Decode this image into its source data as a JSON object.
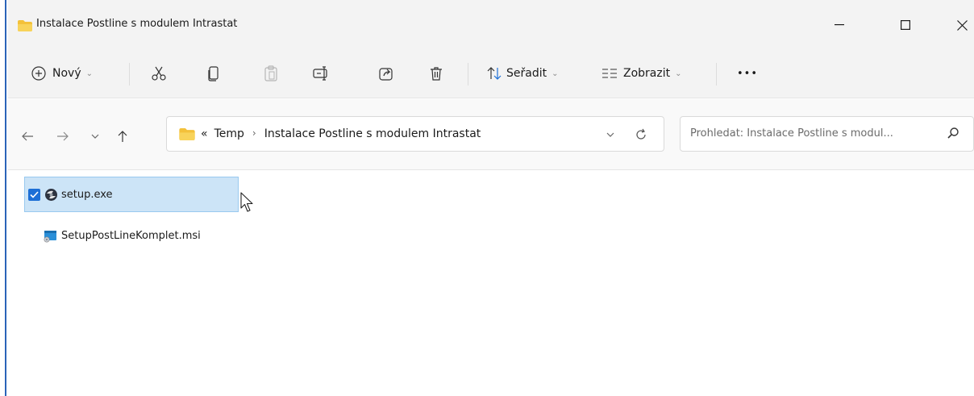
{
  "window": {
    "title": "Instalace Postline s modulem Intrastat"
  },
  "toolbar": {
    "new_label": "Nový",
    "sort_label": "Seřadit",
    "view_label": "Zobrazit",
    "more_label": "•••"
  },
  "address_bar": {
    "overflow": "«",
    "crumbs": [
      "Temp",
      "Instalace Postline s modulem Intrastat"
    ],
    "separator": "›"
  },
  "search": {
    "placeholder": "Prohledat: Instalace Postline s modul..."
  },
  "files": [
    {
      "name": "setup.exe",
      "selected": true,
      "icon": "setup-exe-icon"
    },
    {
      "name": "SetupPostLineKomplet.msi",
      "selected": false,
      "icon": "msi-installer-icon"
    }
  ],
  "colors": {
    "accent": "#1d6fd6",
    "selection": "#cce4f7",
    "folder": "#f3c13a"
  }
}
